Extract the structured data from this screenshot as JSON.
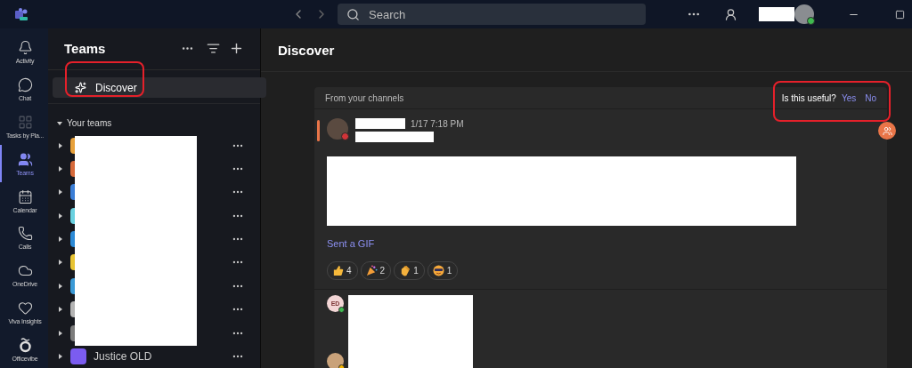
{
  "top_bar": {
    "search": {
      "placeholder": "Search"
    }
  },
  "rail": [
    {
      "label": "Activity",
      "selected": false
    },
    {
      "label": "Chat",
      "selected": false
    },
    {
      "label": "Tasks by Pla...",
      "selected": false
    },
    {
      "label": "Teams",
      "selected": true
    },
    {
      "label": "Calendar",
      "selected": false
    },
    {
      "label": "Calls",
      "selected": false
    },
    {
      "label": "OneDrive",
      "selected": false
    },
    {
      "label": "Viva Insights",
      "selected": false
    },
    {
      "label": "Officevibe",
      "selected": false
    }
  ],
  "teams_panel": {
    "title": "Teams",
    "discover": {
      "label": "Discover",
      "selected": true
    },
    "section": {
      "label": "Your teams",
      "expanded": true
    },
    "team_rows": [
      {
        "expanded": false
      },
      {
        "expanded": false
      },
      {
        "expanded": false
      },
      {
        "expanded": false
      },
      {
        "expanded": false
      },
      {
        "expanded": false
      },
      {
        "expanded": false
      },
      {
        "expanded": false
      },
      {
        "expanded": false
      },
      {
        "expanded": false,
        "name": "Justice OLD"
      }
    ]
  },
  "main": {
    "title": "Discover",
    "card": {
      "header": "From your channels",
      "feedback": {
        "question": "Is this useful?",
        "yes": "Yes",
        "no": "No"
      },
      "post": {
        "time": "1/17 7:18 PM",
        "link": "Sent a GIF",
        "reactions": [
          {
            "kind": "thumbs-up",
            "count": "4"
          },
          {
            "kind": "party",
            "count": "2"
          },
          {
            "kind": "clap",
            "count": "1"
          },
          {
            "kind": "cool",
            "count": "1"
          }
        ]
      },
      "replies": [
        {
          "initials": "ED",
          "color": "#3fb950"
        },
        {
          "color": "#f2b400"
        }
      ]
    }
  }
}
